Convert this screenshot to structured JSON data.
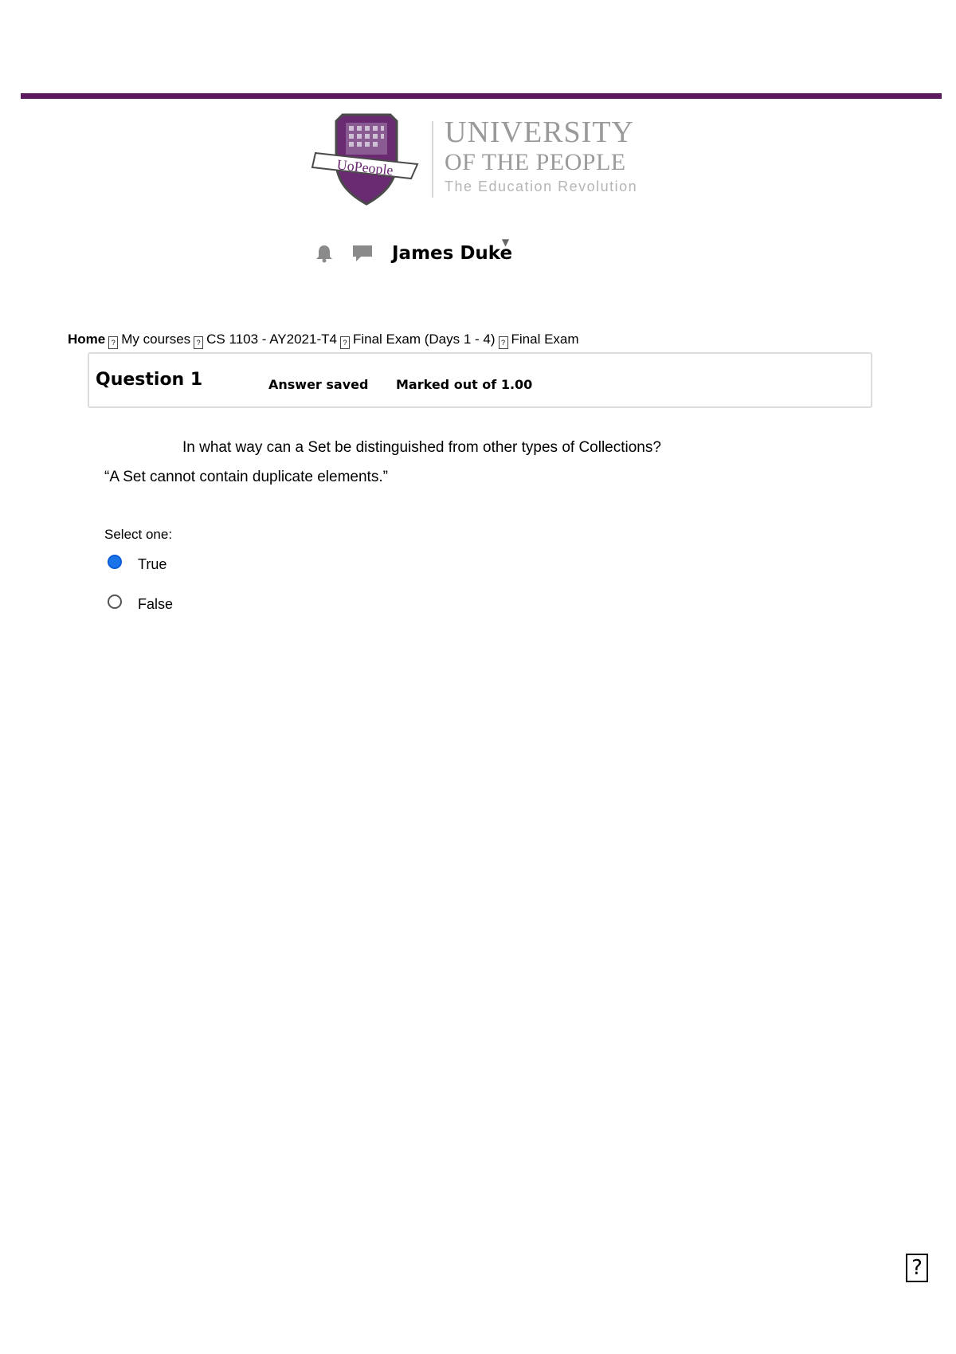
{
  "brand": {
    "line1": "UNIVERSITY",
    "line2": "OF THE PEOPLE",
    "line3": "The Education Revolution",
    "shield_text": "UoPeople",
    "accent_color": "#5b1a5e"
  },
  "user_bar": {
    "notification_icon": "bell-icon",
    "messages_icon": "chat-bubble-icon",
    "user_name": "James Duke",
    "caret": "▼"
  },
  "breadcrumb": {
    "items": [
      "Home",
      "My courses",
      "CS 1103 - AY2021-T4",
      "Final Exam (Days 1 - 4)",
      "Final Exam"
    ],
    "separator": "?"
  },
  "question": {
    "title": "Question 1",
    "status": "Answer saved",
    "mark": "Marked out of 1.00",
    "text": "In what way can a Set be distinguished from other types of Collections?",
    "statement": "“A Set cannot contain duplicate elements.”",
    "select_label": "Select one:",
    "options": [
      {
        "label": "True",
        "selected": true
      },
      {
        "label": "False",
        "selected": false
      }
    ]
  },
  "footer": {
    "help_glyph": "?"
  }
}
